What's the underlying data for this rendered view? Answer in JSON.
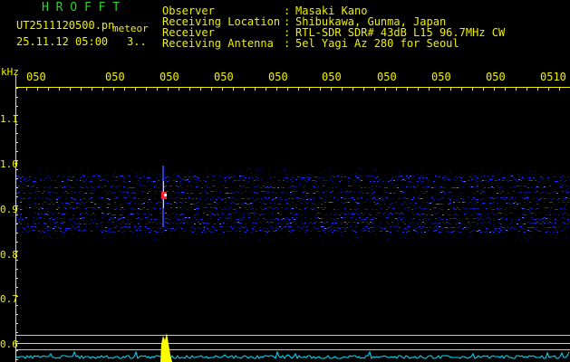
{
  "header": {
    "app_name": "H R O F F T",
    "filename": "UT2511120500.pn",
    "tag": "meteor",
    "datetime": "25.11.12 05:00",
    "counter": "3..",
    "fields": [
      {
        "label": "Observer",
        "value": "Masaki Kano"
      },
      {
        "label": "Receiving Location",
        "value": "Shibukawa, Gunma, Japan"
      },
      {
        "label": "Receiver",
        "value": "RTL-SDR SDR# 43dB L15 96.7MHz CW"
      },
      {
        "label": "Receiving Antenna",
        "value": "5el Yagi Az 280 for Seoul"
      }
    ]
  },
  "axis": {
    "unit": "kHz",
    "freq_ticks": [
      "1.1",
      "1.0",
      "0.9",
      "0.8",
      "0.7",
      "0.6"
    ],
    "time_ticks": [
      "050",
      "050",
      "050",
      "050",
      "050",
      "050",
      "050",
      "050",
      "050",
      "0510"
    ]
  },
  "colors": {
    "label": "#f0f000",
    "title": "#30d030",
    "trace": "#00e0ff",
    "meteor": "#ffff00",
    "band": "#1a2aff"
  }
}
